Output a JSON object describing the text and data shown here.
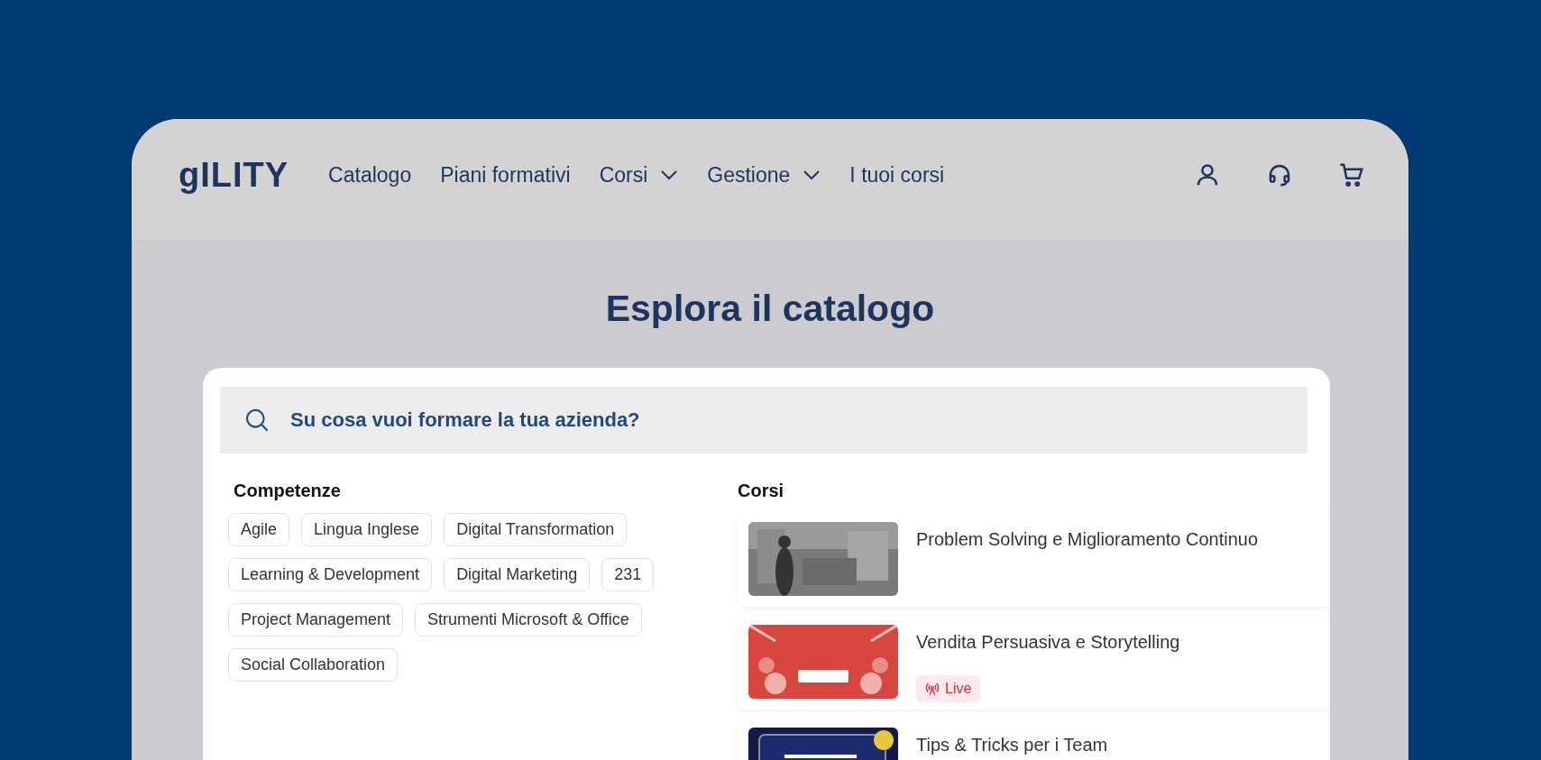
{
  "logo": "gILITY",
  "nav": [
    {
      "label": "Catalogo",
      "dropdown": false
    },
    {
      "label": "Piani formativi",
      "dropdown": false
    },
    {
      "label": "Corsi",
      "dropdown": true
    },
    {
      "label": "Gestione",
      "dropdown": true
    },
    {
      "label": "I tuoi corsi",
      "dropdown": false
    }
  ],
  "heading": "Esplora il catalogo",
  "search": {
    "placeholder": "Su cosa vuoi formare la tua azienda?"
  },
  "skills": {
    "title": "Competenze",
    "chips": [
      "Agile",
      "Lingua Inglese",
      "Digital Transformation",
      "Learning & Development",
      "Digital Marketing",
      "231",
      "Project Management",
      "Strumenti Microsoft & Office",
      "Social Collaboration"
    ]
  },
  "courses": {
    "title": "Corsi",
    "items": [
      {
        "title": "Problem Solving e Miglioramento Continuo"
      },
      {
        "title": "Vendita Persuasiva e Storytelling",
        "badge": "Live"
      },
      {
        "title": "Tips & Tricks per i Team"
      }
    ]
  }
}
